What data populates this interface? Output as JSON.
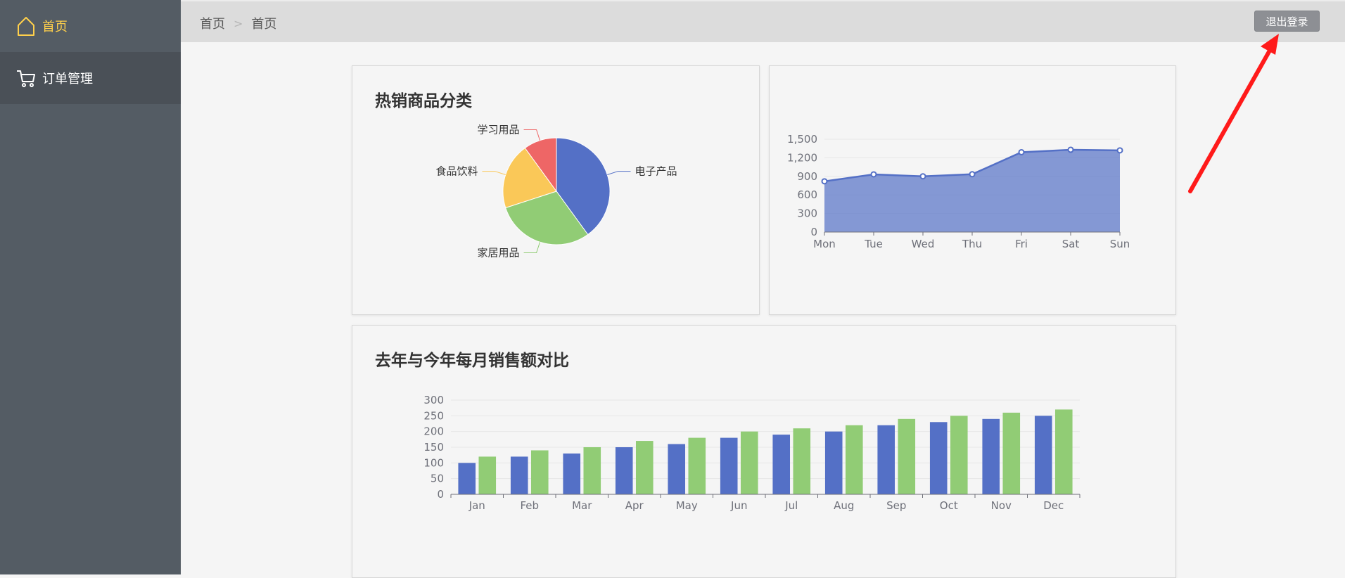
{
  "sidebar": {
    "items": [
      {
        "label": "首页",
        "icon": "home-icon",
        "active": true
      },
      {
        "label": "订单管理",
        "icon": "cart-icon",
        "active": false
      }
    ],
    "active_color": "#ffd04b",
    "background": "#545c64"
  },
  "header": {
    "breadcrumb": [
      "首页",
      "首页"
    ],
    "logout_label": "退出登录"
  },
  "charts": {
    "pie_title": "热销商品分类",
    "bar_title": "去年与今年每月销售额对比"
  },
  "chart_data": [
    {
      "type": "pie",
      "title": "热销商品分类",
      "slices": [
        {
          "label": "电子产品",
          "value": 40,
          "color": "#5470c6"
        },
        {
          "label": "家居用品",
          "value": 30,
          "color": "#91cc75"
        },
        {
          "label": "食品饮料",
          "value": 20,
          "color": "#fac858"
        },
        {
          "label": "学习用品",
          "value": 10,
          "color": "#ee6666"
        }
      ]
    },
    {
      "type": "area",
      "categories": [
        "Mon",
        "Tue",
        "Wed",
        "Thu",
        "Fri",
        "Sat",
        "Sun"
      ],
      "values": [
        820,
        932,
        901,
        934,
        1290,
        1330,
        1320
      ],
      "yticks": [
        "0",
        "300",
        "600",
        "900",
        "1,200",
        "1,500"
      ],
      "ylim": [
        0,
        1500
      ],
      "color": "#5470c6",
      "grid": true
    },
    {
      "type": "bar",
      "title": "去年与今年每月销售额对比",
      "categories": [
        "Jan",
        "Feb",
        "Mar",
        "Apr",
        "May",
        "Jun",
        "Jul",
        "Aug",
        "Sep",
        "Oct",
        "Nov",
        "Dec"
      ],
      "series": [
        {
          "values": [
            100,
            120,
            130,
            150,
            160,
            180,
            190,
            200,
            220,
            230,
            240,
            250
          ],
          "color": "#5470c6"
        },
        {
          "values": [
            120,
            140,
            150,
            170,
            180,
            200,
            210,
            220,
            240,
            250,
            260,
            270
          ],
          "color": "#91cc75"
        }
      ],
      "yticks": [
        "0",
        "50",
        "100",
        "150",
        "200",
        "250",
        "300"
      ],
      "ylim": [
        0,
        300
      ],
      "grid": true
    }
  ]
}
